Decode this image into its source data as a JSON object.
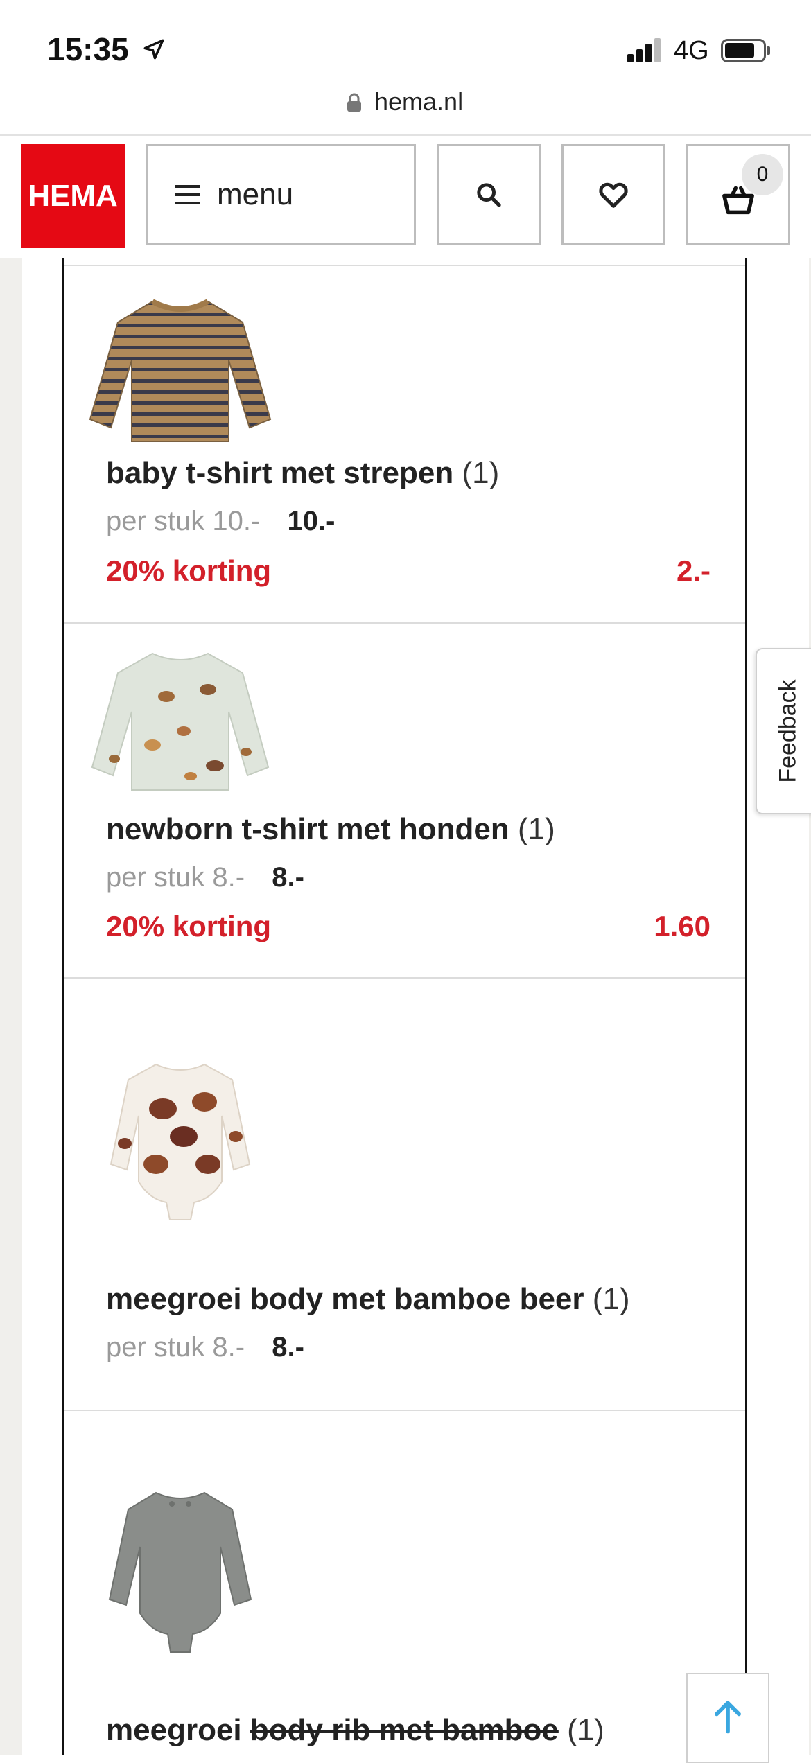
{
  "status_bar": {
    "time": "15:35",
    "network": "4G"
  },
  "browser": {
    "url": "hema.nl"
  },
  "header": {
    "logo_text": "HEMA",
    "menu_label": "menu",
    "cart_count": "0",
    "brand_color": "#e50914"
  },
  "products": [
    {
      "name": "baby t-shirt met strepen",
      "qty": "(1)",
      "unit_label": "per stuk",
      "old_price": "10.-",
      "price": "10.-",
      "discount_label": "20% korting",
      "discount_amount": "2.-",
      "image_icon": "striped-longsleeve-shirt"
    },
    {
      "name": "newborn t-shirt met honden",
      "qty": "(1)",
      "unit_label": "per stuk",
      "old_price": "8.-",
      "price": "8.-",
      "discount_label": "20% korting",
      "discount_amount": "1.60",
      "image_icon": "dog-print-longsleeve-shirt"
    },
    {
      "name": "meegroei body met bamboe beer",
      "qty": "(1)",
      "unit_label": "per stuk",
      "old_price": "8.-",
      "price": "8.-",
      "image_icon": "bear-print-bodysuit"
    },
    {
      "name_part1": "meegroei ",
      "name_part2": "body rib met bamboe",
      "qty": "(1)",
      "image_icon": "grey-rib-bodysuit"
    }
  ],
  "feedback_label": "Feedback",
  "accent_red": "#d3202a"
}
